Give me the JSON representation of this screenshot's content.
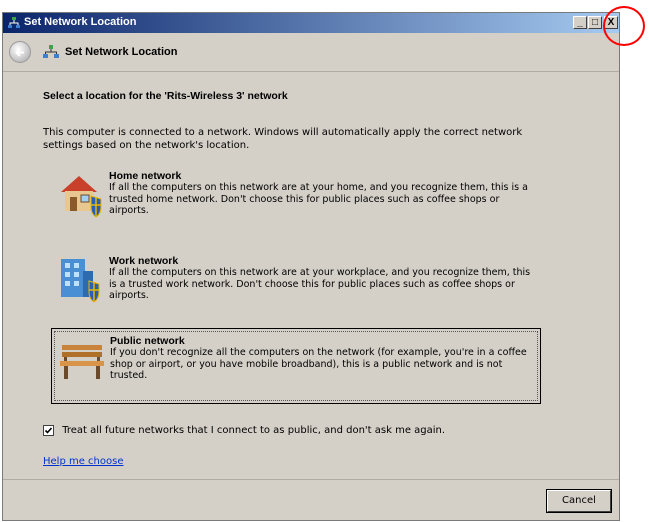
{
  "window": {
    "title": "Set Network Location",
    "minimize_label": "_",
    "maximize_label": "□",
    "close_label": "X"
  },
  "nav": {
    "title": "Set Network Location"
  },
  "main": {
    "heading": "Select a location for the 'Rits-Wireless  3' network",
    "intro": "This computer is connected to a network. Windows will automatically apply the correct network settings based on the network's location.",
    "options": [
      {
        "title": "Home network",
        "description": "If all the computers on this network are at your home, and you recognize them, this is a trusted home network.  Don't choose this for public places such as coffee shops or airports.",
        "icon": "home-icon",
        "selected": false
      },
      {
        "title": "Work network",
        "description": "If all the computers on this network are at your workplace, and you recognize them, this is a trusted work network.  Don't choose this for public places such as coffee shops or airports.",
        "icon": "office-building-icon",
        "selected": false
      },
      {
        "title": "Public network",
        "description": "If you don't recognize all the computers on the network (for example, you're in a coffee shop or airport, or you have mobile broadband), this is a public network and is not trusted.",
        "icon": "park-bench-icon",
        "selected": true
      }
    ],
    "checkbox_label": "Treat all future networks that I connect to as public, and don't ask me again.",
    "checkbox_checked": true,
    "help_link": "Help me choose"
  },
  "footer": {
    "cancel_label": "Cancel"
  },
  "colors": {
    "titlebar_start": "#0a246a",
    "titlebar_end": "#a6caf0",
    "dialog_bg": "#d4d0c8",
    "link": "#0033cc",
    "highlight": "#ff0000"
  }
}
